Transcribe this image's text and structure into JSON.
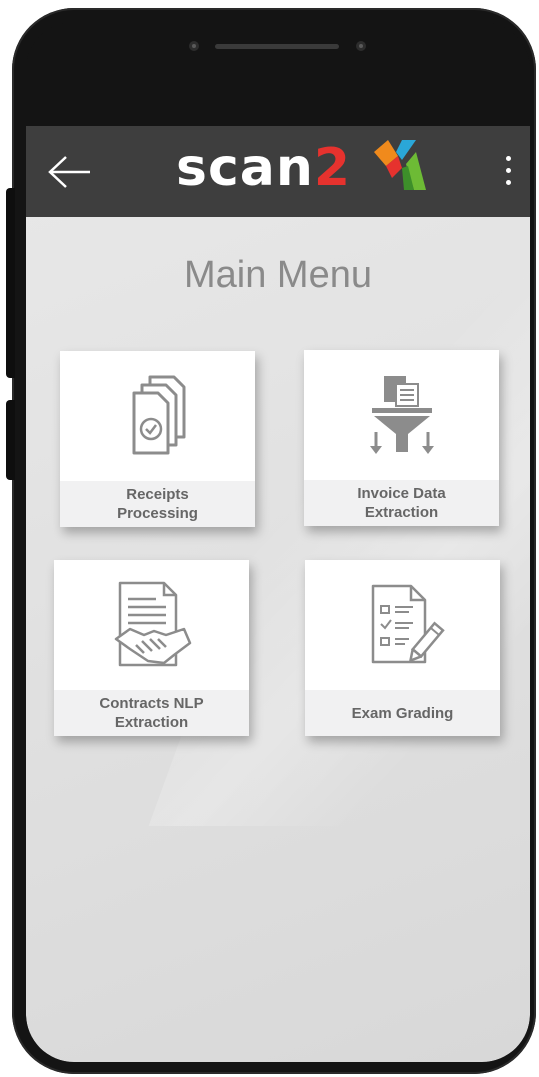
{
  "app": {
    "logo_text_main": "scan",
    "logo_text_num": "2",
    "logo_mark": "scan2x-chevron-mark"
  },
  "appbar": {
    "back_icon": "arrow-left-icon",
    "menu_icon": "kebab-menu-icon"
  },
  "main": {
    "title": "Main Menu",
    "tiles": [
      {
        "label": "Receipts\nProcessing",
        "icon": "stacked-documents-check-icon"
      },
      {
        "label": "Invoice Data\nExtraction",
        "icon": "documents-funnel-icon"
      },
      {
        "label": "Contracts NLP\nExtraction",
        "icon": "contract-handshake-icon"
      },
      {
        "label": "Exam Grading",
        "icon": "checklist-pencil-icon"
      }
    ]
  },
  "colors": {
    "appbar": "#3e3e3e",
    "logo_red": "#e6322e",
    "tile_label_bg": "#f1f1f2",
    "icon_gray": "#8c8c8c"
  }
}
